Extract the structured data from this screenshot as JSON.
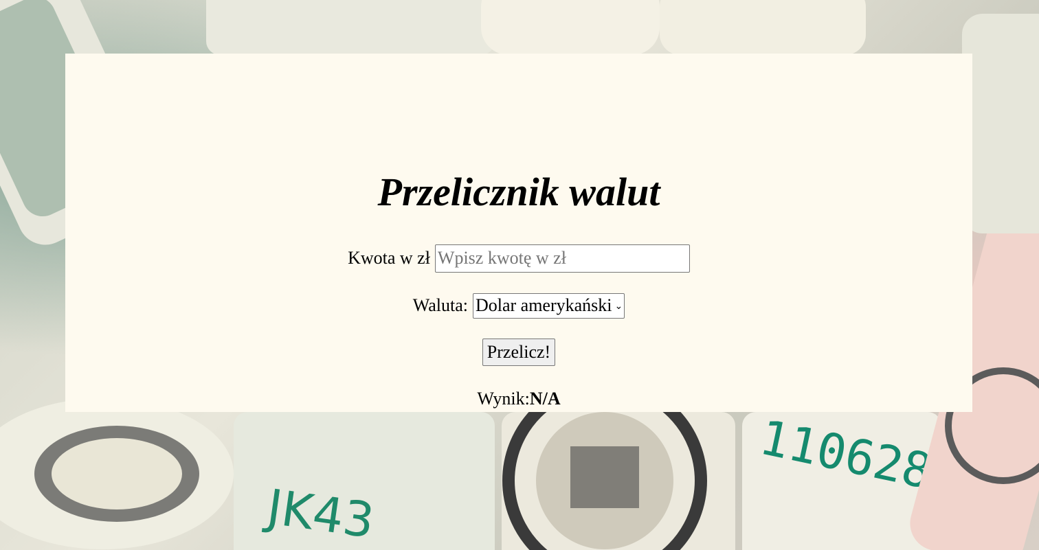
{
  "title": "Przelicznik walut",
  "amount": {
    "label": "Kwota w zł",
    "value": "",
    "placeholder": "Wpisz kwotę w zł"
  },
  "currency": {
    "label": "Waluta:",
    "selected": "Dolar amerykański"
  },
  "convert_button": "Przelicz!",
  "result": {
    "label": "Wynik:",
    "value": "N/A"
  },
  "colors": {
    "card_background": "#fefaef",
    "text": "#000000"
  },
  "icons": {
    "select_arrow": "chevron-down-icon"
  }
}
